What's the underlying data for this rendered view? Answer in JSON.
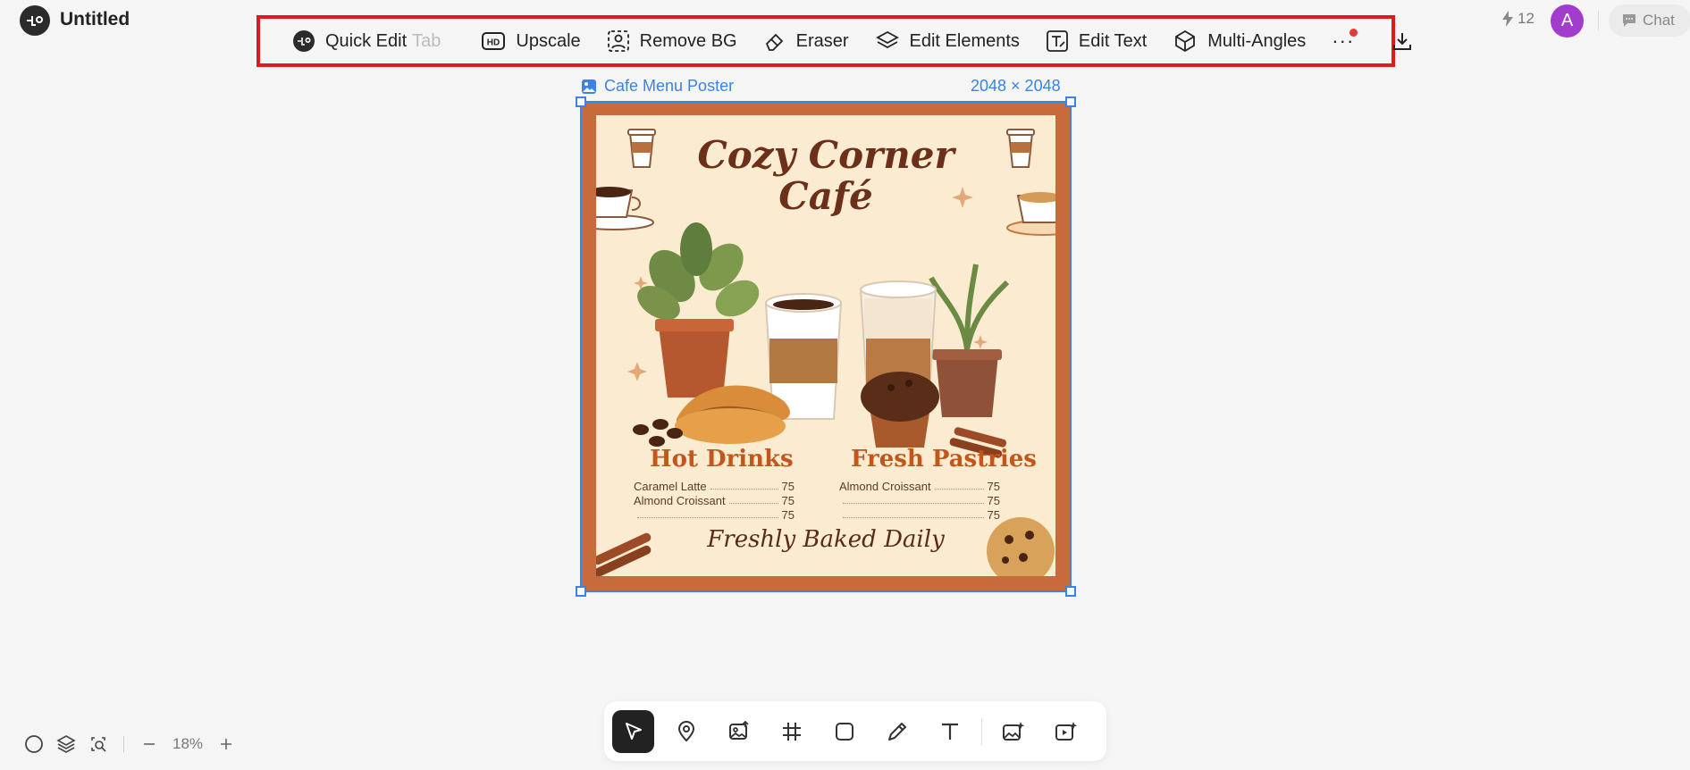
{
  "app": {
    "title": "Untitled"
  },
  "toolbar": {
    "items": [
      {
        "label": "Quick Edit",
        "hint": "Tab",
        "icon": "quick-edit-icon"
      },
      {
        "label": "Upscale",
        "icon": "hd-icon"
      },
      {
        "label": "Remove BG",
        "icon": "remove-bg-icon"
      },
      {
        "label": "Eraser",
        "icon": "eraser-icon"
      },
      {
        "label": "Edit Elements",
        "icon": "layers-icon"
      },
      {
        "label": "Edit Text",
        "icon": "edit-text-icon"
      },
      {
        "label": "Multi-Angles",
        "icon": "cube-icon"
      }
    ],
    "more_label": "···",
    "download_icon": "download-icon",
    "highlight_color": "#e01a1a"
  },
  "header_right": {
    "credits": "12",
    "avatar_letter": "A",
    "chat_label": "Chat",
    "avatar_color": "#a23ccc"
  },
  "canvas": {
    "frame_label": "Cafe Menu Poster",
    "frame_size": "2048 × 2048",
    "selection_color": "#3a82e8"
  },
  "poster": {
    "title_line1": "Cozy Corner",
    "title_line2": "Café",
    "section_left": "Hot Drinks",
    "section_right": "Fresh Pastries",
    "left_items": [
      {
        "name": "Caramel Latte",
        "price": "75"
      },
      {
        "name": "Almond Croissant",
        "price": "75"
      },
      {
        "name": "",
        "price": "75"
      }
    ],
    "right_items": [
      {
        "name": "Almond Croissant",
        "price": "75"
      },
      {
        "name": "",
        "price": "75"
      },
      {
        "name": "",
        "price": "75"
      }
    ],
    "tagline": "Freshly Baked Daily"
  },
  "zoom": {
    "value": "18%"
  },
  "bottom_toolbar": [
    "select-cursor-icon",
    "location-pin-icon",
    "image-upload-icon",
    "frame-hash-icon",
    "rectangle-icon",
    "pencil-icon",
    "text-icon",
    "ai-image-icon",
    "ai-video-icon"
  ]
}
